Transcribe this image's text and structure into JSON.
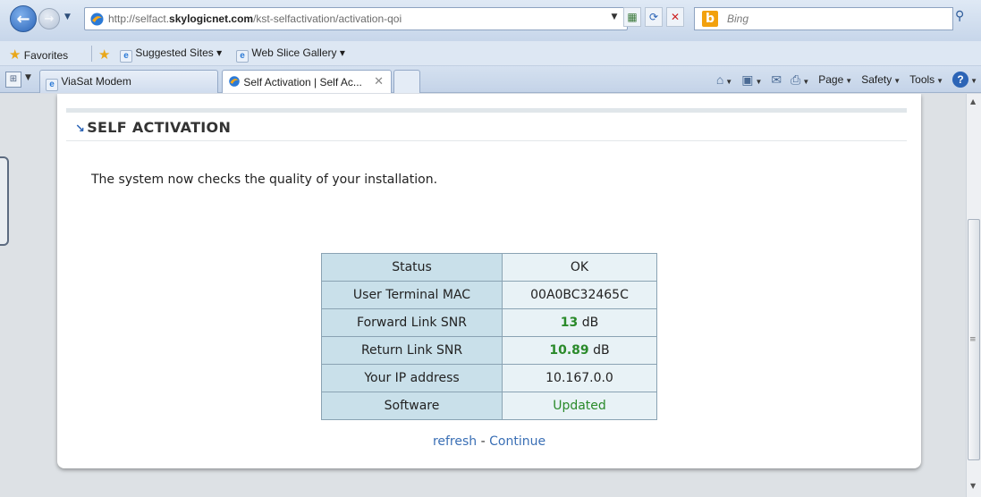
{
  "browser": {
    "url_prefix": "http://selfact.",
    "url_domain": "skylogicnet.com",
    "url_path": "/kst-selfactivation/activation-qoi",
    "search_placeholder": "Bing",
    "favorites_label": "Favorites",
    "suggested_sites_label": "Suggested Sites ▾",
    "web_slice_label": "Web Slice Gallery ▾",
    "tabs": [
      {
        "label": "ViaSat Modem"
      },
      {
        "label": "Self Activation | Self Ac..."
      }
    ],
    "command_bar": {
      "page_label": "Page",
      "safety_label": "Safety",
      "tools_label": "Tools"
    }
  },
  "page": {
    "section_title": "SELF ACTIVATION",
    "intro": "The system now checks the quality of your installation.",
    "status_rows": [
      {
        "label": "Status",
        "value": "OK"
      },
      {
        "label": "User Terminal MAC",
        "value": "00A0BC32465C"
      },
      {
        "label": "Forward Link SNR",
        "value_number": "13",
        "value_unit": " dB"
      },
      {
        "label": "Return Link SNR",
        "value_number": "10.89",
        "value_unit": " dB"
      },
      {
        "label": "Your IP address",
        "value": "10.167.0.0"
      },
      {
        "label": "Software",
        "value": "Updated"
      }
    ],
    "actions": {
      "refresh_label": "refresh",
      "separator": " - ",
      "continue_label": "Continue"
    }
  },
  "colors": {
    "accent_link": "#3a6fb5",
    "status_good": "#2a8a2a",
    "table_label_bg": "#c9e0ea",
    "table_value_bg": "#e8f2f6"
  },
  "icons": [
    "back-icon",
    "forward-icon",
    "site-icon",
    "compatibility-icon",
    "refresh-icon",
    "stop-icon",
    "bing-icon",
    "search-icon",
    "star-icon",
    "home-icon",
    "feeds-icon",
    "mail-icon",
    "print-icon",
    "help-icon",
    "close-icon"
  ]
}
